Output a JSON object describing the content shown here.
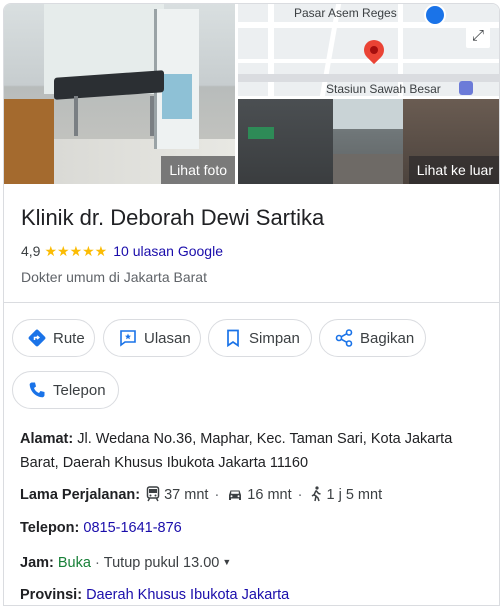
{
  "photos": {
    "main_label": "Lihat foto",
    "outside_label": "Lihat ke luar"
  },
  "map": {
    "label_top": "Pasar Asem Reges",
    "label_station": "Stasiun Sawah Besar"
  },
  "place": {
    "name": "Klinik dr. Deborah Dewi Sartika",
    "rating": "4,9",
    "stars": "★★★★★",
    "reviews": "10 ulasan Google",
    "category": "Dokter umum di Jakarta Barat"
  },
  "actions": [
    {
      "label": "Rute",
      "icon": "directions-icon"
    },
    {
      "label": "Ulasan",
      "icon": "review-icon"
    },
    {
      "label": "Simpan",
      "icon": "bookmark-icon"
    },
    {
      "label": "Bagikan",
      "icon": "share-icon"
    },
    {
      "label": "Telepon",
      "icon": "phone-icon"
    }
  ],
  "info": {
    "address_label": "Alamat:",
    "address_line1": "Jl. Wedana No.36, Maphar, Kec. Taman Sari, Kota Jakarta",
    "address_line2": "Barat, Daerah Khusus Ibukota Jakarta 11160",
    "travel_label": "Lama Perjalanan:",
    "travel_transit": "37 mnt",
    "travel_car": "16 mnt",
    "travel_walk": "1 j 5 mnt",
    "phone_label": "Telepon:",
    "phone_value": "0815-1641-876",
    "hours_label": "Jam:",
    "hours_status": "Buka",
    "hours_close": "Tutup pukul 13.00",
    "province_label": "Provinsi:",
    "province_value": "Daerah Khusus Ibukota Jakarta"
  },
  "colors": {
    "accent": "#1a73e8",
    "link": "#1a0dab",
    "open": "#188038",
    "star": "#fbbc04"
  }
}
